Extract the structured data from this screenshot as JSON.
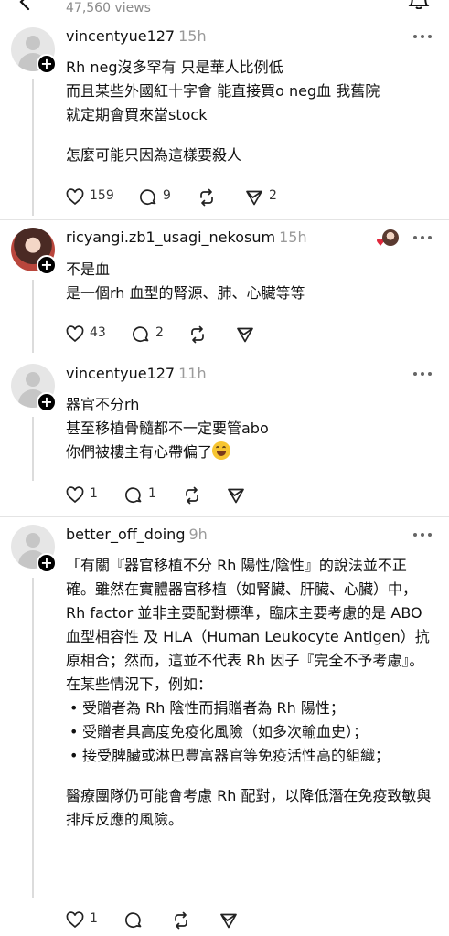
{
  "header": {
    "views": "47,560 views"
  },
  "comments": [
    {
      "username": "vincentyue127",
      "time": "15h",
      "lines": [
        "Rh neg沒多罕有 只是華人比例低",
        "而且某些外國紅十字會 能直接買o neg血 我舊院",
        "就定期會買來當stock",
        "怎麼可能只因為這樣要殺人"
      ],
      "likes": "159",
      "replies": "9",
      "reposts": "",
      "shares": "2"
    },
    {
      "username": "ricyangi.zb1_usagi_nekosum",
      "time": "15h",
      "lines": [
        "不是血",
        "是一個rh 血型的腎源、肺、心臟等等"
      ],
      "likes": "43",
      "replies": "2",
      "reposts": "",
      "shares": ""
    },
    {
      "username": "vincentyue127",
      "time": "11h",
      "lines": [
        "器官不分rh",
        "甚至移植骨髓都不一定要管abo",
        "你們被樓主有心帶偏了"
      ],
      "likes": "1",
      "replies": "1",
      "reposts": "",
      "shares": ""
    },
    {
      "username": "better_off_doing",
      "time": "9h",
      "paragraph": "「有關『器官移植不分 Rh 陽性/陰性』的說法並不正確。雖然在實體器官移植（如腎臟、肝臟、心臟）中，Rh factor 並非主要配對標準，臨床主要考慮的是 ABO 血型相容性 及 HLA（Human Leukocyte Antigen）抗原相合；然而，這並不代表 Rh 因子『完全不予考慮』。在某些情況下，例如：",
      "bullets": [
        "受贈者為 Rh 陰性而捐贈者為 Rh 陽性；",
        "受贈者具高度免疫化風險（如多次輸血史）；",
        "接受脾臟或淋巴豐富器官等免疫活性高的組織；"
      ],
      "closing": "醫療團隊仍可能會考慮 Rh 配對，以降低潛在免疫致敏與排斥反應的風險。",
      "likes": "1",
      "replies": "",
      "reposts": "",
      "shares": ""
    }
  ],
  "icons": {
    "back": "back-arrow-icon",
    "bell": "notification-icon",
    "like": "heart-icon",
    "reply": "comment-icon",
    "repost": "repost-icon",
    "share": "share-icon",
    "more": "more-options-icon",
    "follow": "plus-icon",
    "emoji": "grinning-sweat-emoji"
  }
}
